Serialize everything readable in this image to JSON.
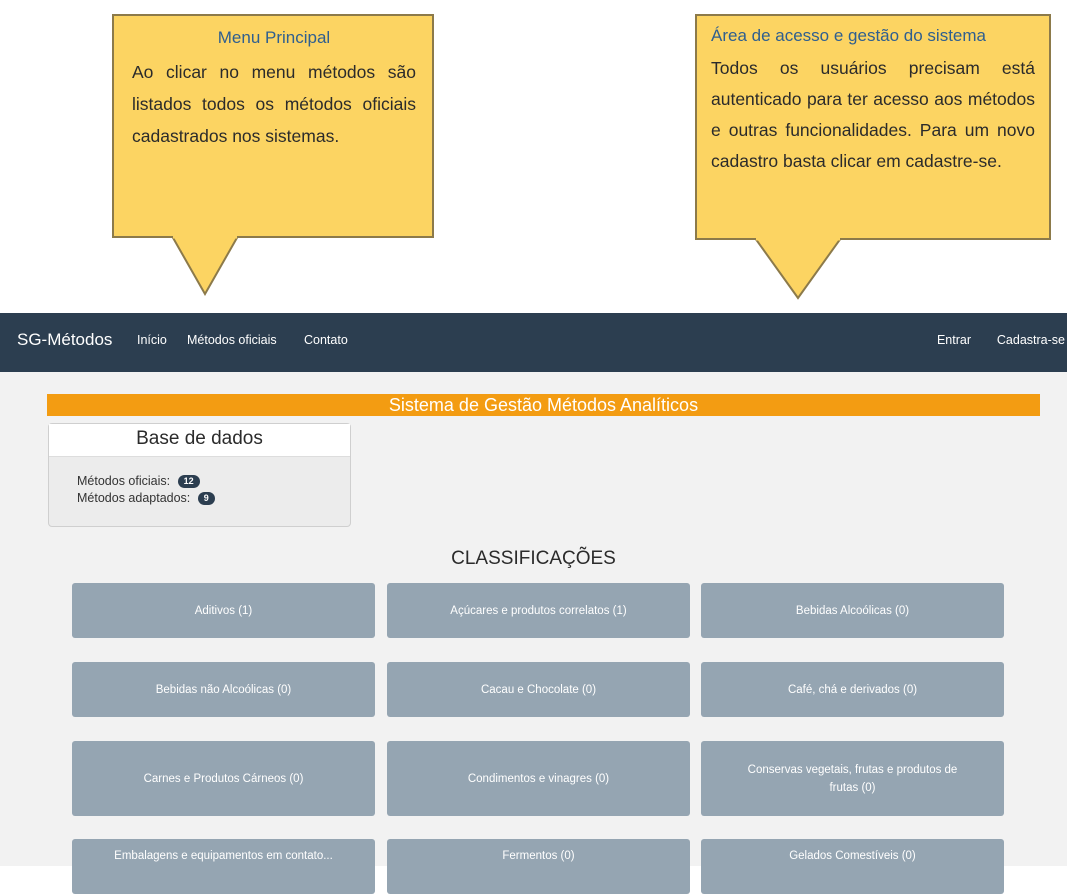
{
  "callouts": {
    "left": {
      "title": "Menu Principal",
      "body": "Ao clicar no menu métodos são listados todos os métodos oficiais cadastrados nos sistemas."
    },
    "right": {
      "title": "Área de acesso e gestão do sistema",
      "body": "Todos os usuários precisam está autenticado para ter acesso aos métodos e outras funcionalidades. Para um novo cadastro basta clicar em cadastre-se."
    }
  },
  "navbar": {
    "brand": "SG-Métodos",
    "links": [
      "Início",
      "Métodos oficiais",
      "Contato"
    ],
    "right_links": [
      "Entrar",
      "Cadastra-se"
    ]
  },
  "banner": "Sistema de Gestão Métodos Analíticos",
  "database_panel": {
    "title": "Base de dados",
    "rows": [
      {
        "label": "Métodos oficiais:",
        "count": "12"
      },
      {
        "label": "Métodos adaptados:",
        "count": "9"
      }
    ]
  },
  "classifications": {
    "title": "CLASSIFICAÇÕES",
    "items": [
      "Aditivos (1)",
      "Açúcares e produtos correlatos (1)",
      "Bebidas Alcoólicas (0)",
      "Bebidas não Alcoólicas (0)",
      "Cacau e Chocolate (0)",
      "Café, chá e derivados (0)",
      "Carnes e Produtos Cárneos (0)",
      "Condimentos e vinagres (0)",
      "Conservas vegetais, frutas e produtos de frutas (0)",
      "Embalagens e equipamentos em contato...",
      "Fermentos (0)",
      "Gelados Comestíveis (0)"
    ]
  },
  "colors": {
    "navbar": "#2c3e50",
    "banner": "#f39c12",
    "callout": "#fcd462",
    "button": "#95a5b2"
  }
}
